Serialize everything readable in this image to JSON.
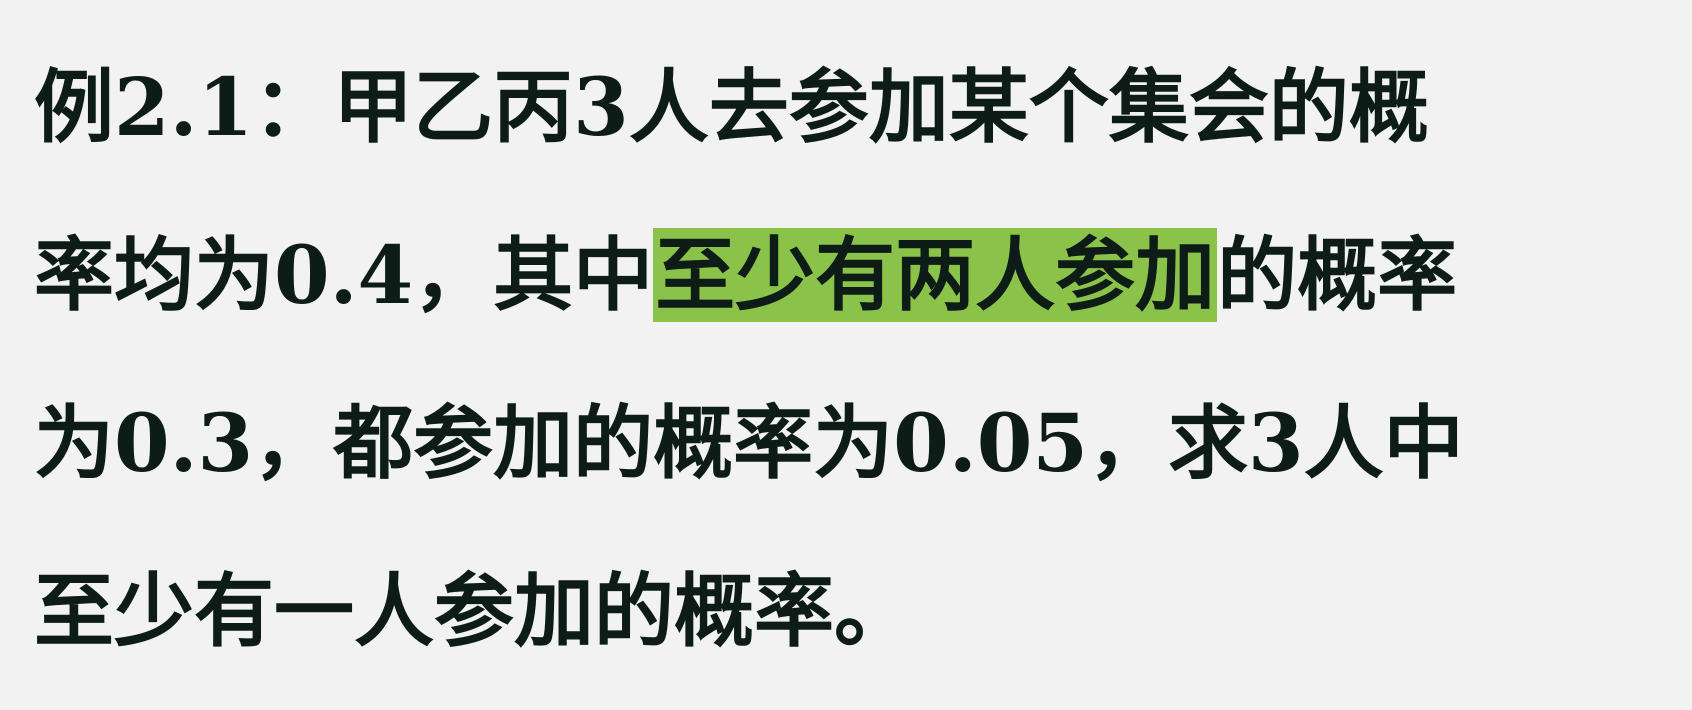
{
  "document": {
    "lines": [
      {
        "text": "例2.1：甲乙丙3人去参加某个集会的概"
      },
      {
        "pre": "率均为0.4，其中",
        "highlight": "至少有两人参加",
        "post": "的概率"
      },
      {
        "text": "为0.3，都参加的概率为0.05，求3人中"
      },
      {
        "text": "至少有一人参加的概率。"
      }
    ],
    "highlight_color": "#8bc34a",
    "text_color": "#0d1c17",
    "background_color": "#f2f2f2"
  }
}
